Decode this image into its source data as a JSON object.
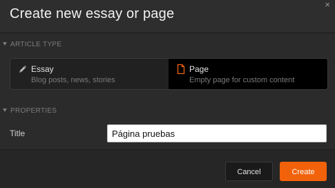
{
  "dialog": {
    "title": "Create new essay or page",
    "close_symbol": "×"
  },
  "article_type": {
    "heading": "ARTICLE TYPE",
    "options": [
      {
        "name": "Essay",
        "description": "Blog posts, news, stories",
        "icon": "pen-icon",
        "selected": false
      },
      {
        "name": "Page",
        "description": "Empty page for custom content",
        "icon": "document-icon",
        "selected": true
      }
    ]
  },
  "properties": {
    "heading": "PROPERTIES",
    "title_label": "Title",
    "title_value": "Página pruebas"
  },
  "footer": {
    "cancel_label": "Cancel",
    "create_label": "Create"
  },
  "colors": {
    "accent": "#f2620a",
    "selected_bg": "#000000"
  }
}
